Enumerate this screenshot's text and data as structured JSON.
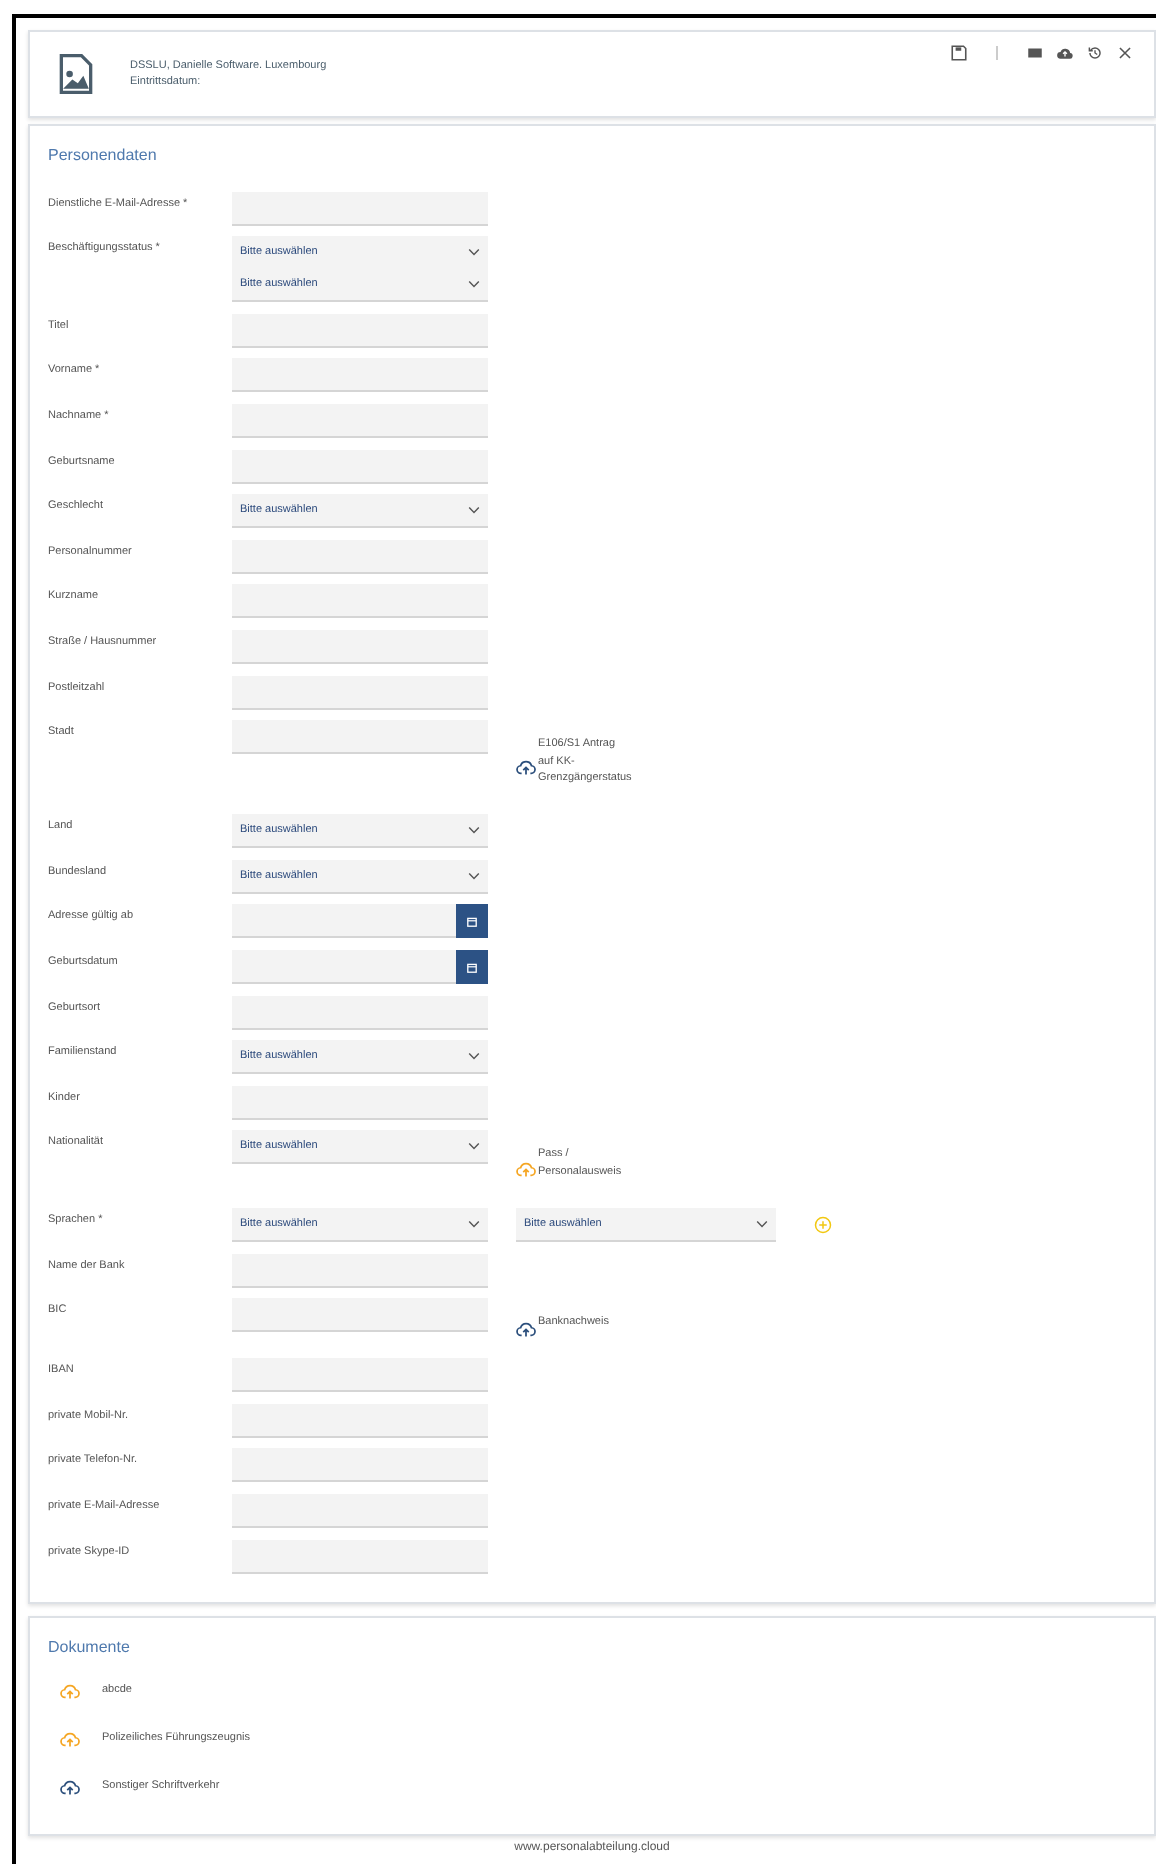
{
  "header": {
    "company": "DSSLU, Danielle Software. Luxembourg",
    "entry_date_label": "Eintrittsdatum:"
  },
  "personal": {
    "title": "Personendaten",
    "rows": [
      {
        "label": "Dienstliche E-Mail-Adresse *",
        "kind": "text"
      },
      {
        "label": "Beschäftigungsstatus *",
        "kind": "select",
        "value": "Bitte auswählen"
      },
      {
        "kind": "select",
        "value": "Bitte auswählen"
      },
      {
        "label": "Titel",
        "kind": "text"
      },
      {
        "label": "Vorname *",
        "kind": "text"
      },
      {
        "label": "Nachname *",
        "kind": "text"
      },
      {
        "label": "Geburtsname",
        "kind": "text"
      },
      {
        "label": "Geschlecht",
        "kind": "select",
        "value": "Bitte auswählen"
      },
      {
        "label": "Personalnummer",
        "kind": "text"
      },
      {
        "label": "Kurzname",
        "kind": "text"
      },
      {
        "label": "Straße / Hausnummer",
        "kind": "text"
      },
      {
        "label": "Postleitzahl",
        "kind": "text"
      },
      {
        "label": "Stadt",
        "kind": "text",
        "upload": {
          "text": "E106/S1 Antrag auf KK-Grenzgängerstatus",
          "color": "#2c4f7c"
        }
      },
      {
        "label": "Land",
        "kind": "select",
        "value": "Bitte auswählen"
      },
      {
        "label": "Bundesland",
        "kind": "select",
        "value": "Bitte auswählen"
      },
      {
        "label": "Adresse gültig ab",
        "kind": "date"
      },
      {
        "label": "Geburtsdatum",
        "kind": "date"
      },
      {
        "label": "Geburtsort",
        "kind": "text"
      },
      {
        "label": "Familienstand",
        "kind": "select",
        "value": "Bitte auswählen"
      },
      {
        "label": "Kinder",
        "kind": "text"
      },
      {
        "label": "Nationalität",
        "kind": "select",
        "value": "Bitte auswählen",
        "upload": {
          "text": "Pass / Personalausweis",
          "color": "#f5a623"
        }
      },
      {
        "label": "Sprachen *",
        "kind": "select",
        "value": "Bitte auswählen",
        "extra_select": "Bitte auswählen"
      },
      {
        "label": "Name der Bank",
        "kind": "text"
      },
      {
        "label": "BIC",
        "kind": "text",
        "upload": {
          "text": "Banknachweis",
          "color": "#2c4f7c"
        }
      },
      {
        "label": "IBAN",
        "kind": "text"
      },
      {
        "label": "private Mobil-Nr.",
        "kind": "text"
      },
      {
        "label": "private Telefon-Nr.",
        "kind": "text"
      },
      {
        "label": "private E-Mail-Adresse",
        "kind": "text"
      },
      {
        "label": "private Skype-ID",
        "kind": "text"
      }
    ]
  },
  "documents": {
    "title": "Dokumente",
    "items": [
      {
        "name": "abcde",
        "color": "#f5a623"
      },
      {
        "name": "Polizeiliches Führungszeugnis",
        "color": "#f5a623"
      },
      {
        "name": "Sonstiger Schriftverkehr",
        "color": "#2c4f7c"
      }
    ]
  },
  "footer": "www.personalabteilung.cloud"
}
